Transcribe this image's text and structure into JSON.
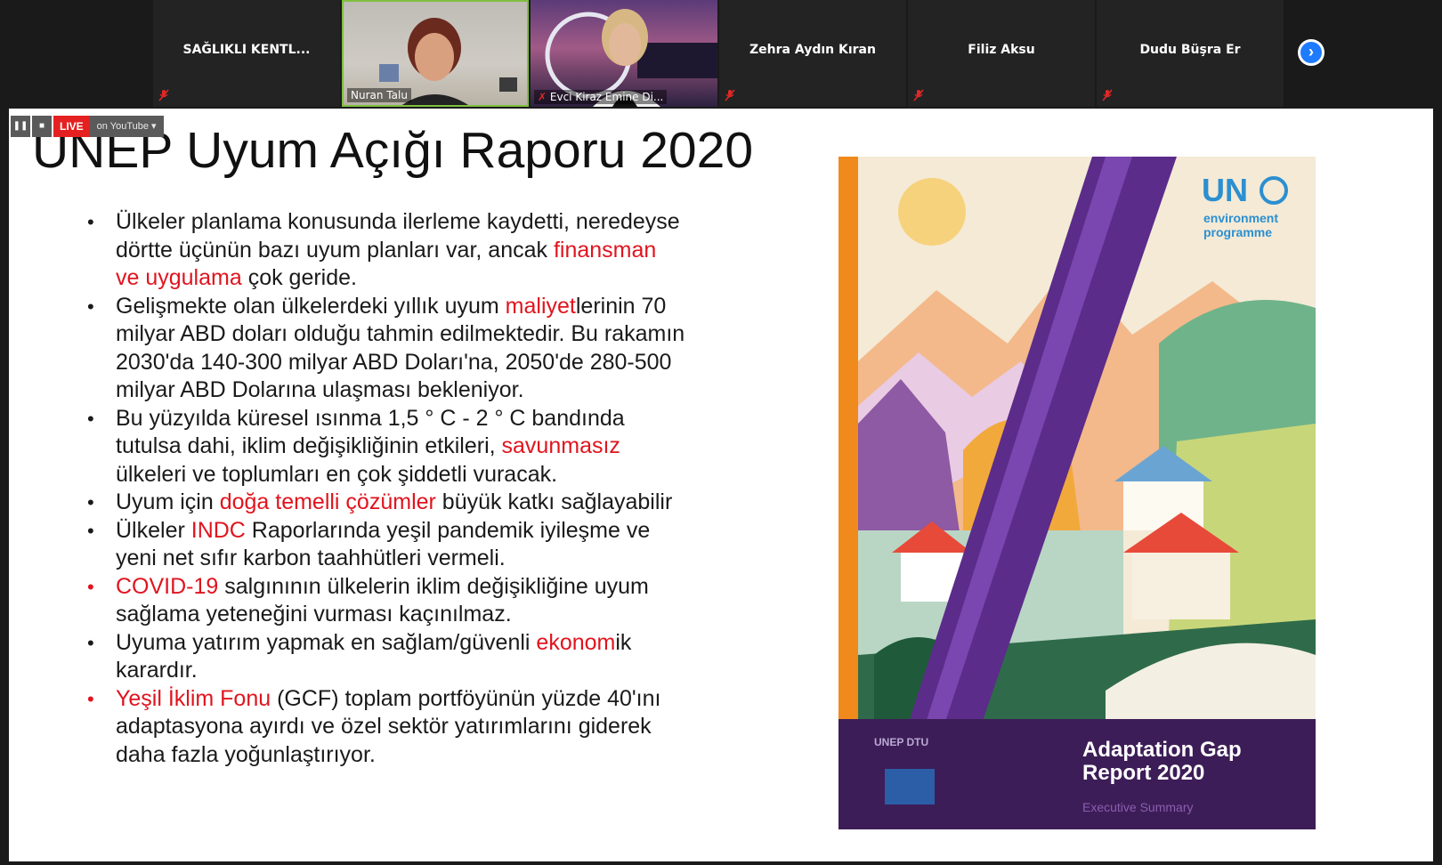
{
  "meeting": {
    "participants": [
      {
        "name": "SAĞLIKLI KENTL...",
        "type": "name"
      },
      {
        "name": "Nuran Talu",
        "type": "video"
      },
      {
        "name": "Evci Kiraz Emine Di...",
        "type": "video"
      },
      {
        "name": "Zehra Aydın Kıran",
        "type": "name"
      },
      {
        "name": "Filiz Aksu",
        "type": "name"
      },
      {
        "name": "Dudu Büşra Er",
        "type": "name"
      }
    ],
    "mic_state": "muted",
    "next_icon": "chevron-right-icon"
  },
  "live": {
    "pause": "❚❚",
    "stop": "■",
    "badge": "LIVE",
    "platform": "on YouTube ▾"
  },
  "slide": {
    "title": "UNEP Uyum Açığı Raporu 2020",
    "bullets": [
      {
        "bullet_color": "black",
        "parts": [
          {
            "t": "Ülkeler planlama konusunda ilerleme kaydetti, neredeyse dörtte üçünün bazı uyum planları var, ancak "
          },
          {
            "t": "finansman ve uygulama",
            "hl": true
          },
          {
            "t": " çok geride."
          }
        ]
      },
      {
        "bullet_color": "black",
        "parts": [
          {
            "t": "Gelişmekte olan ülkelerdeki yıllık uyum "
          },
          {
            "t": "maliyet",
            "hl": true
          },
          {
            "t": "lerinin 70 milyar ABD doları olduğu tahmin edilmektedir. Bu rakamın 2030'da 140-300 milyar ABD Doları'na, 2050'de 280-500 milyar ABD Dolarına ulaşması bekleniyor."
          }
        ]
      },
      {
        "bullet_color": "black",
        "parts": [
          {
            "t": " Bu yüzyılda küresel ısınma 1,5 ° C - 2 ° C bandında tutulsa dahi, iklim değişikliğinin etkileri, "
          },
          {
            "t": "savunmasız",
            "hl": true
          },
          {
            "t": " ülkeleri ve toplumları en çok şiddetli vuracak."
          }
        ]
      },
      {
        "bullet_color": "black",
        "parts": [
          {
            "t": "Uyum için "
          },
          {
            "t": "doğa temelli çözümler",
            "hl": true
          },
          {
            "t": " büyük katkı sağlayabilir"
          }
        ]
      },
      {
        "bullet_color": "black",
        "parts": [
          {
            "t": "Ülkeler "
          },
          {
            "t": "INDC",
            "hl": true
          },
          {
            "t": " Raporlarında yeşil pandemik iyileşme ve yeni net sıfır karbon taahhütleri vermeli."
          }
        ]
      },
      {
        "bullet_color": "red",
        "parts": [
          {
            "t": "COVID-19",
            "hl": true
          },
          {
            "t": " salgınının ülkelerin iklim değişikliğine uyum sağlama yeteneğini vurması kaçınılmaz."
          }
        ]
      },
      {
        "bullet_color": "black",
        "parts": [
          {
            "t": "Uyuma yatırım yapmak en sağlam/güvenli "
          },
          {
            "t": "ekonom",
            "hl": true
          },
          {
            "t": "ik karardır."
          }
        ]
      },
      {
        "bullet_color": "red",
        "parts": [
          {
            "t": "Yeşil İklim Fonu",
            "hl": true
          },
          {
            "t": " (GCF) toplam portföyünün yüzde 40'ını adaptasyona ayırdı ve özel sektör yatırımlarını giderek daha fazla yoğunlaştırıyor."
          }
        ]
      }
    ]
  },
  "cover": {
    "logo_un": "UN",
    "logo_sub1": "environment",
    "logo_sub2": "programme",
    "title_line1": "Adaptation Gap",
    "title_line2": "Report 2020",
    "subtitle": "Executive Summary",
    "partner": "UNEP DTU"
  },
  "colors": {
    "highlight": "#e0141e",
    "speaker_border": "#7fbf3f",
    "next_button": "#1e7bff",
    "cover_purple": "#3d1d57",
    "cover_orange": "#f08a1c"
  }
}
